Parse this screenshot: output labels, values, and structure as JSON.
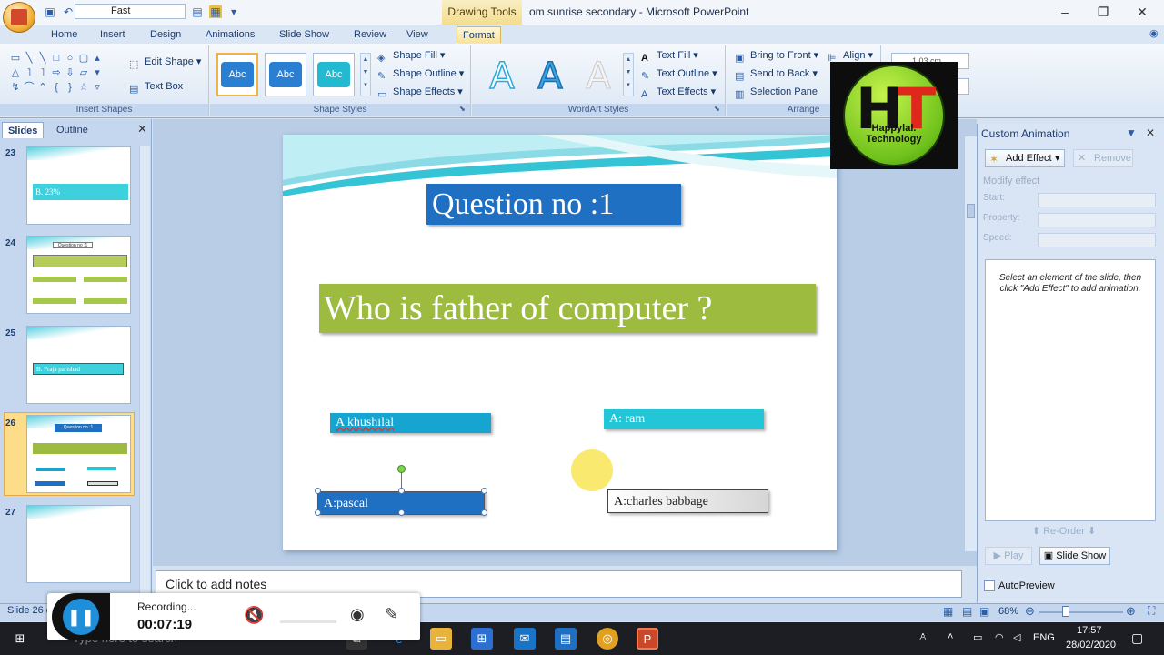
{
  "window": {
    "contextual_tab_title": "Drawing Tools",
    "title": "om sunrise secondary - Microsoft PowerPoint",
    "qat_dropdown_value": "Fast"
  },
  "tabs": [
    "Home",
    "Insert",
    "Design",
    "Animations",
    "Slide Show",
    "Review",
    "View",
    "Format"
  ],
  "active_tab": "Format",
  "ribbon": {
    "insert_shapes": {
      "label": "Insert Shapes",
      "edit_shape": "Edit Shape",
      "text_box": "Text Box"
    },
    "shape_styles": {
      "label": "Shape Styles",
      "swatch_text": "Abc",
      "shape_fill": "Shape Fill",
      "shape_outline": "Shape Outline",
      "shape_effects": "Shape Effects",
      "swatch_colors": [
        "#2b7fd3",
        "#2b7fd3",
        "#22b9d1"
      ]
    },
    "wordart_styles": {
      "label": "WordArt Styles",
      "letter": "A",
      "text_fill": "Text Fill",
      "text_outline": "Text Outline",
      "text_effects": "Text Effects"
    },
    "arrange": {
      "label": "Arrange",
      "bring_to_front": "Bring to Front",
      "send_to_back": "Send to Back",
      "selection_pane": "Selection Pane",
      "align": "Align",
      "size_value": "1.03 cm"
    }
  },
  "channel_logo": {
    "text": "Happylal. Technology"
  },
  "slides_pane": {
    "tab_slides": "Slides",
    "tab_outline": "Outline",
    "thumbnails": [
      {
        "number": "23",
        "preview_text": "B. 23%"
      },
      {
        "number": "24",
        "preview_text": "Question no :1"
      },
      {
        "number": "25",
        "preview_text": "B. Praja parishad"
      },
      {
        "number": "26",
        "preview_text": "Question no :1"
      },
      {
        "number": "27",
        "preview_text": ""
      }
    ],
    "selected_slide": "26"
  },
  "slide": {
    "title": "Question  no :1",
    "question": "Who is father of computer ?",
    "options": {
      "a": "A khushilal",
      "b": "A: ram",
      "c": "A:pascal",
      "d": "A:charles babbage"
    },
    "colors": {
      "title_bg": "#1f6fc3",
      "question_bg": "#9dbb3e",
      "option_cyan": "#22c6d6"
    }
  },
  "notes": {
    "placeholder": "Click to add notes"
  },
  "custom_animation": {
    "title": "Custom Animation",
    "add_effect": "Add Effect",
    "remove": "Remove",
    "modify_effect": "Modify effect",
    "start_label": "Start:",
    "property_label": "Property:",
    "speed_label": "Speed:",
    "hint": "Select an element of the slide, then click \"Add Effect\" to add animation.",
    "reorder": "Re-Order",
    "play": "Play",
    "slide_show": "Slide Show",
    "autopreview": "AutoPreview"
  },
  "statusbar": {
    "slide_info": "Slide 26 o",
    "zoom": "68%"
  },
  "recording": {
    "status": "Recording...",
    "time": "00:07:19"
  },
  "taskbar": {
    "search_placeholder": "Type here to search",
    "lang": "ENG",
    "time": "17:57",
    "date": "28/02/2020"
  }
}
